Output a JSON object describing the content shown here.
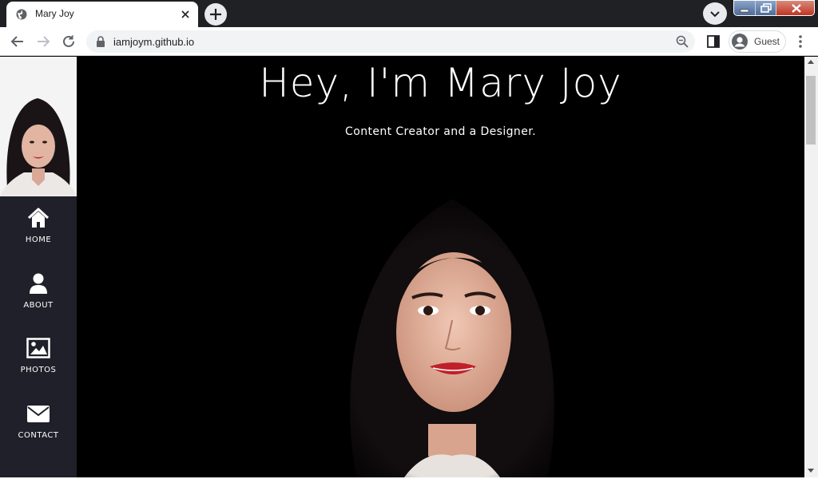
{
  "browser": {
    "tab": {
      "title": "Mary Joy",
      "favicon": "globe-icon"
    },
    "url": "iamjoym.github.io",
    "profile_label": "Guest"
  },
  "sidebar": {
    "items": [
      {
        "label": "HOME",
        "icon": "home-icon"
      },
      {
        "label": "ABOUT",
        "icon": "user-icon"
      },
      {
        "label": "PHOTOS",
        "icon": "image-icon"
      },
      {
        "label": "CONTACT",
        "icon": "envelope-icon"
      }
    ]
  },
  "hero": {
    "title": "Hey, I'm Mary Joy",
    "subtitle": "Content Creator and a Designer."
  },
  "colors": {
    "sidebar_bg": "#1f2029",
    "page_bg": "#000000",
    "text": "#ffffff"
  }
}
